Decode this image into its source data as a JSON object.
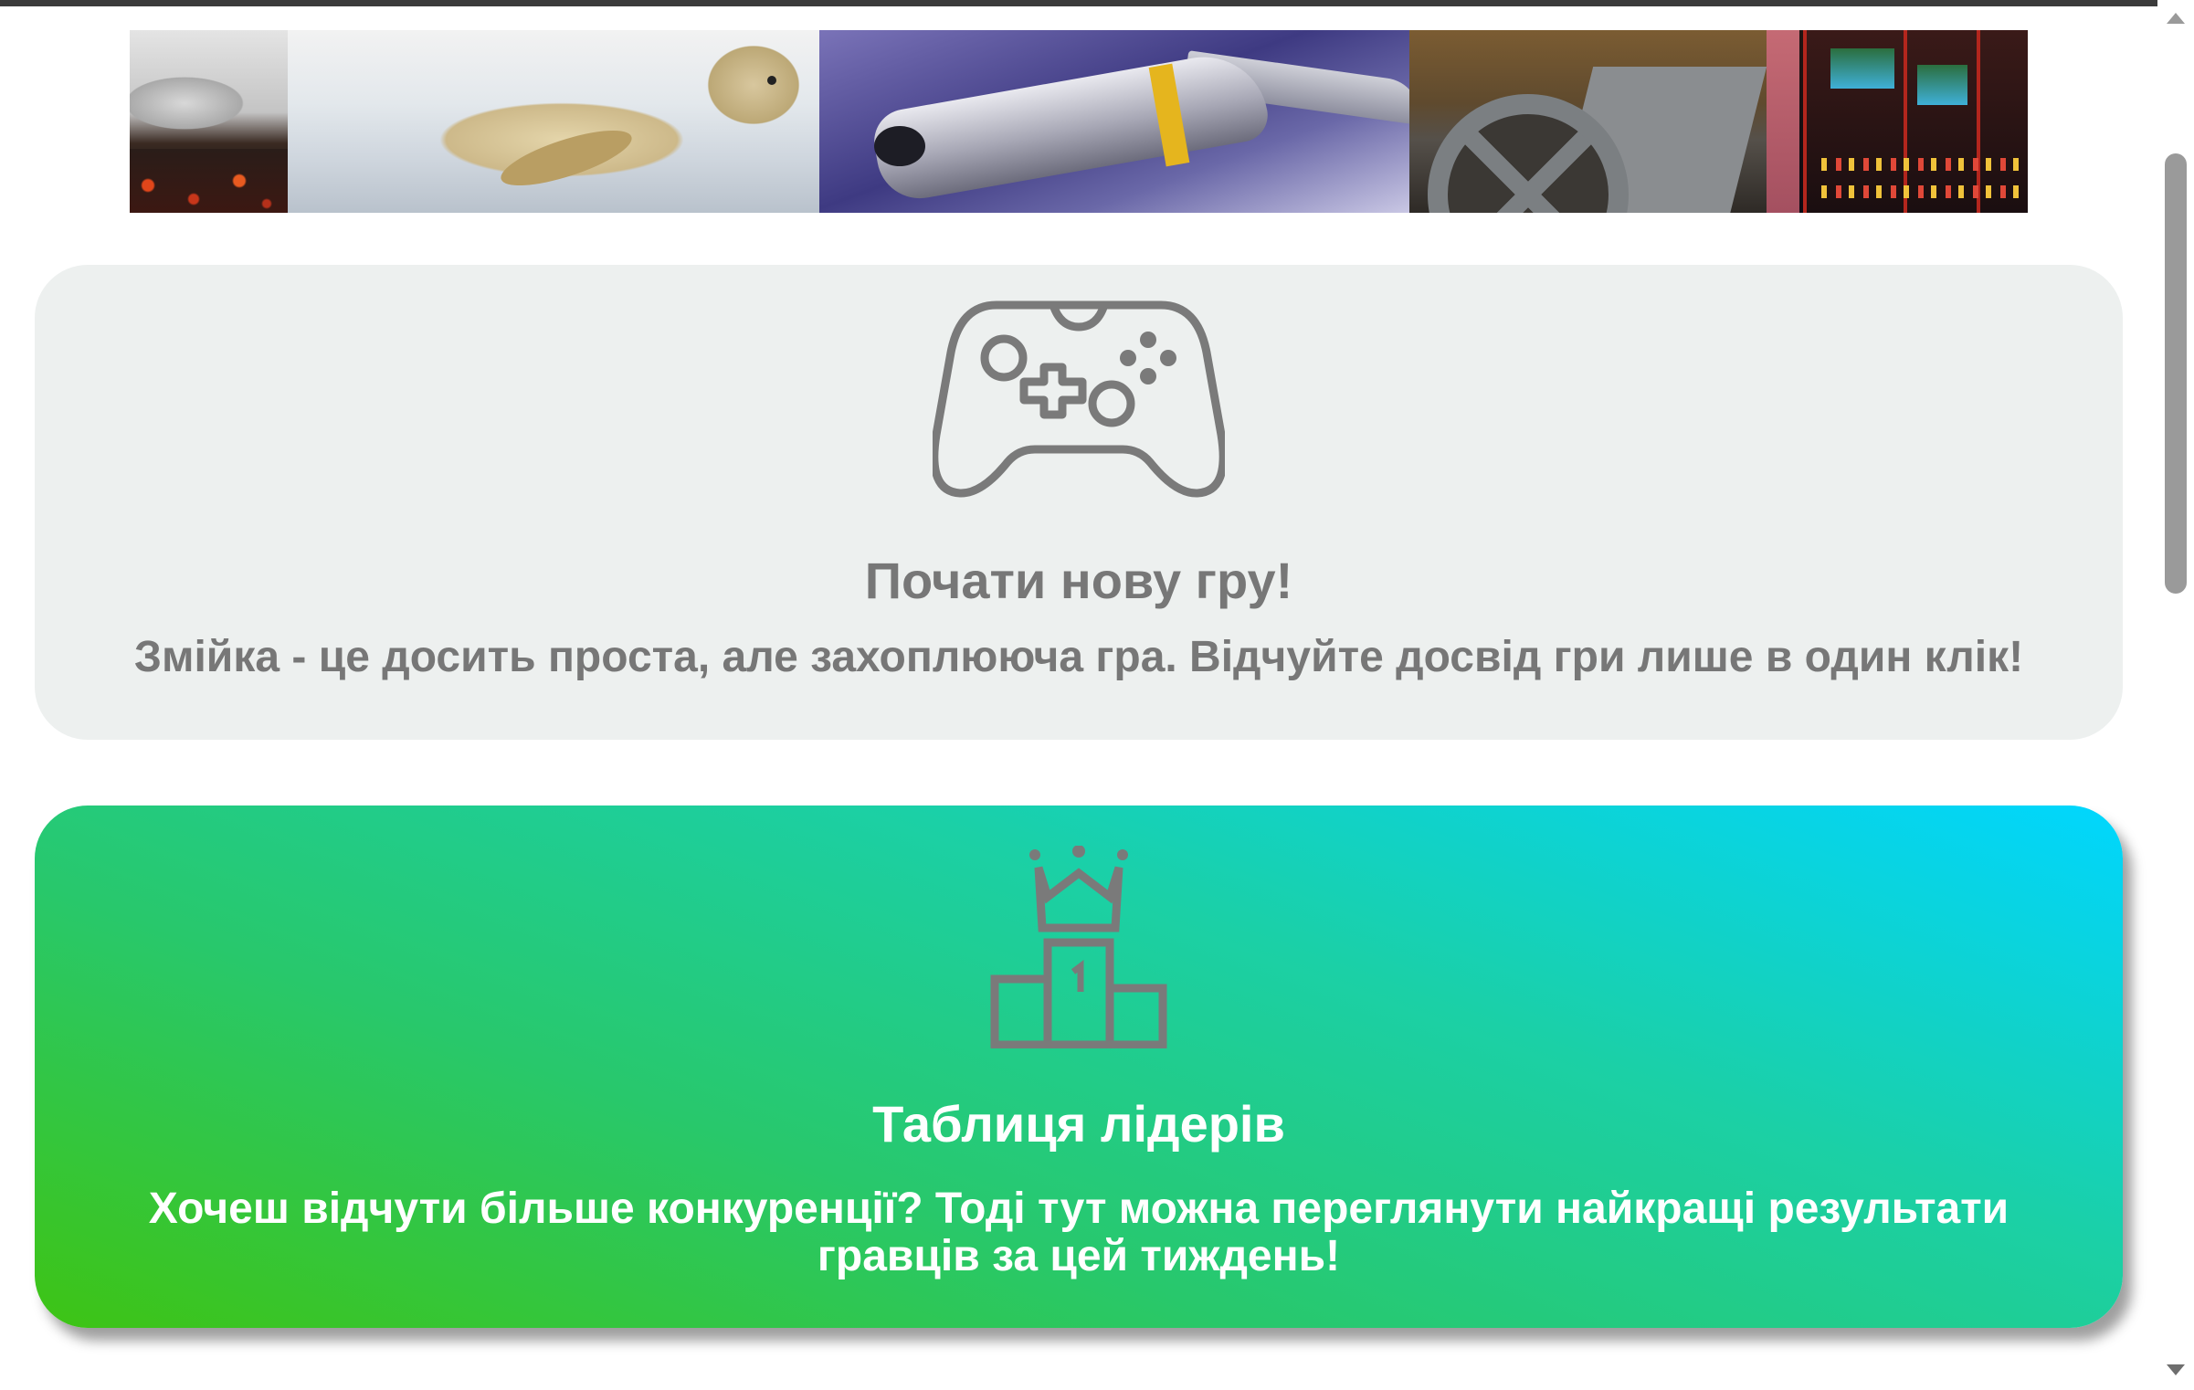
{
  "banner": {
    "icon": "game-collage-banner",
    "tiles": [
      "lava-tile",
      "seal-tile",
      "jet-tile",
      "tank-wheel-tile",
      "arcade-tile"
    ]
  },
  "new_game_card": {
    "icon": "gamepad-icon",
    "title": "Почати нову гру!",
    "text": "Змійка - це досить проста, але захоплююча гра. Відчуйте досвід гри лише в один клік!",
    "background": "#edf0ef",
    "text_color": "#777777"
  },
  "leaderboard_card": {
    "icon": "podium-crown-icon",
    "title": "Таблиця лідерів",
    "text": "Хочеш відчути більше конкуренції? Тоді тут можна переглянути найкращі результати гравців за цей тиждень!",
    "gradient": [
      "#00d6ff",
      "#3ec414"
    ],
    "text_color": "#ffffff"
  },
  "scrollbar": {
    "icon_up": "scroll-up-arrow-icon",
    "icon_down": "scroll-down-arrow-icon"
  }
}
